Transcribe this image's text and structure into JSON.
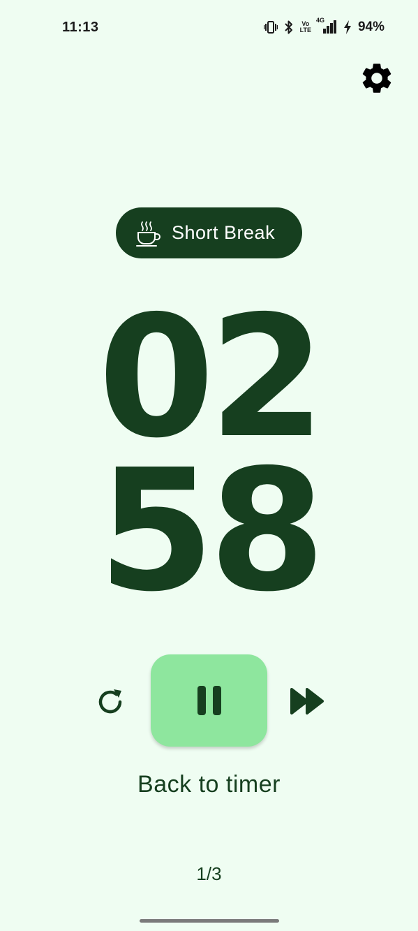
{
  "status_bar": {
    "time": "11:13",
    "battery_percent": "94%",
    "icons": [
      "vibrate-icon",
      "bluetooth-icon",
      "volte-icon",
      "4g-signal-icon",
      "charging-icon"
    ],
    "volte_label_top": "Vo",
    "volte_label_bottom": "LTE",
    "network_label": "4G"
  },
  "header": {
    "settings_icon": "gear-icon"
  },
  "mode": {
    "label": "Short Break",
    "icon": "coffee-cup-icon"
  },
  "timer": {
    "minutes": "02",
    "seconds": "58"
  },
  "controls": {
    "reset_icon": "reset-icon",
    "pause_icon": "pause-icon",
    "skip_icon": "fast-forward-icon"
  },
  "back_link": {
    "label": "Back to timer"
  },
  "session": {
    "count": "1/3"
  },
  "colors": {
    "background": "#effdf2",
    "primary": "#163f1f",
    "accent": "#8ee69e"
  }
}
